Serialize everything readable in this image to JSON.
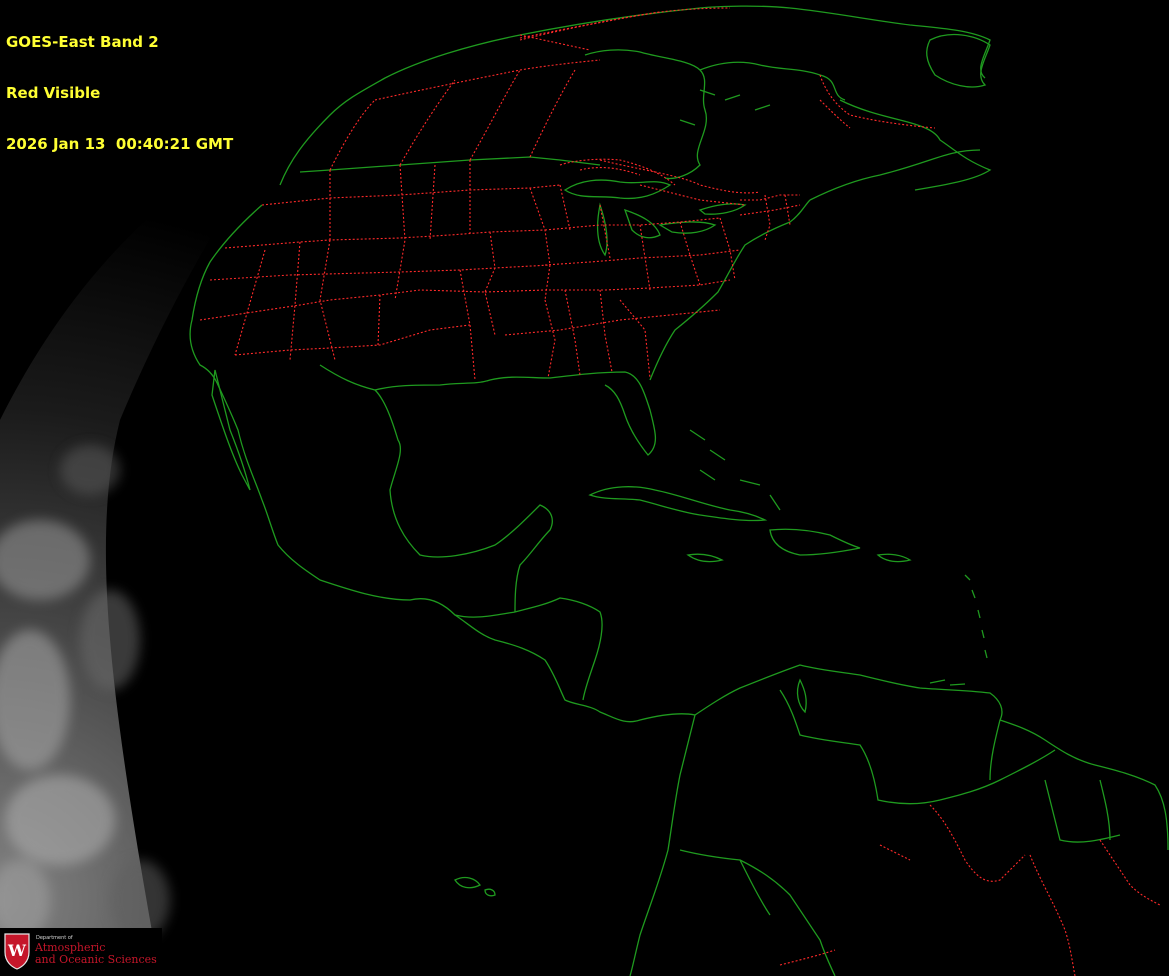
{
  "header": {
    "line1": "GOES-East Band 2",
    "line2": "Red Visible",
    "line3": "2026 Jan 13  00:40:21 GMT"
  },
  "logo": {
    "dept_small": "Department of",
    "dept_line1": "Atmospheric",
    "dept_line2": "and Oceanic Sciences",
    "crest_letter": "W",
    "crest_color": "#c5162a"
  },
  "colors": {
    "background": "#000000",
    "header_text": "#ffff33",
    "coastline": "#1f9a1f",
    "state_borders": "#ff2a2a",
    "earth_limb_cloud": "#7a7a7a"
  }
}
